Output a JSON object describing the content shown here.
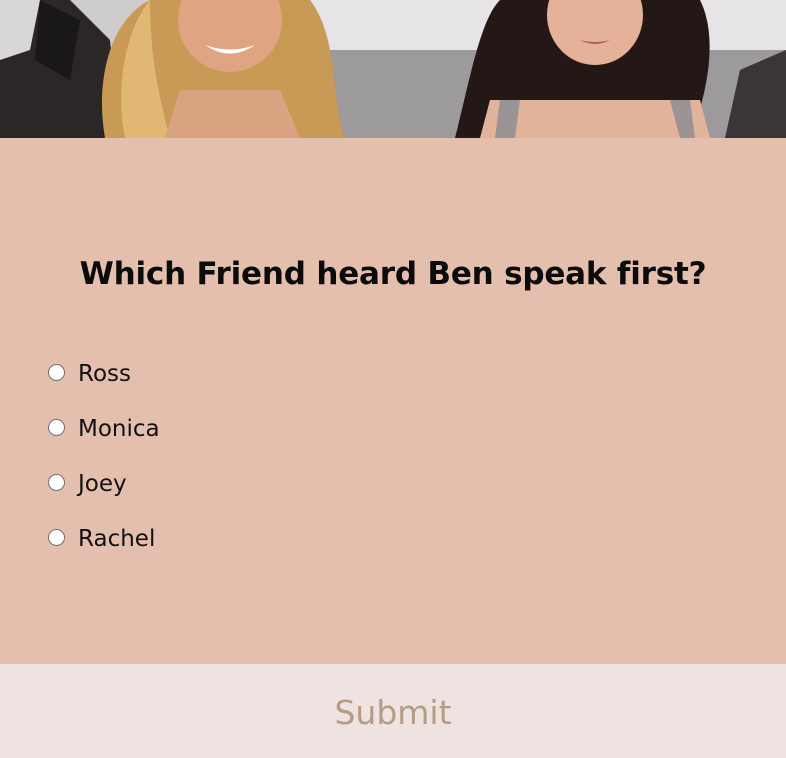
{
  "hero": {
    "image_subject": "cast photo"
  },
  "quiz": {
    "question": "Which Friend heard Ben speak first?",
    "options": [
      {
        "label": "Ross",
        "selected": false
      },
      {
        "label": "Monica",
        "selected": false
      },
      {
        "label": "Joey",
        "selected": false
      },
      {
        "label": "Rachel",
        "selected": false
      }
    ]
  },
  "footer": {
    "submit_label": "Submit"
  },
  "colors": {
    "quiz_background": "#e5bfae",
    "submit_background": "#efe3e2",
    "submit_text": "#b59c86"
  }
}
